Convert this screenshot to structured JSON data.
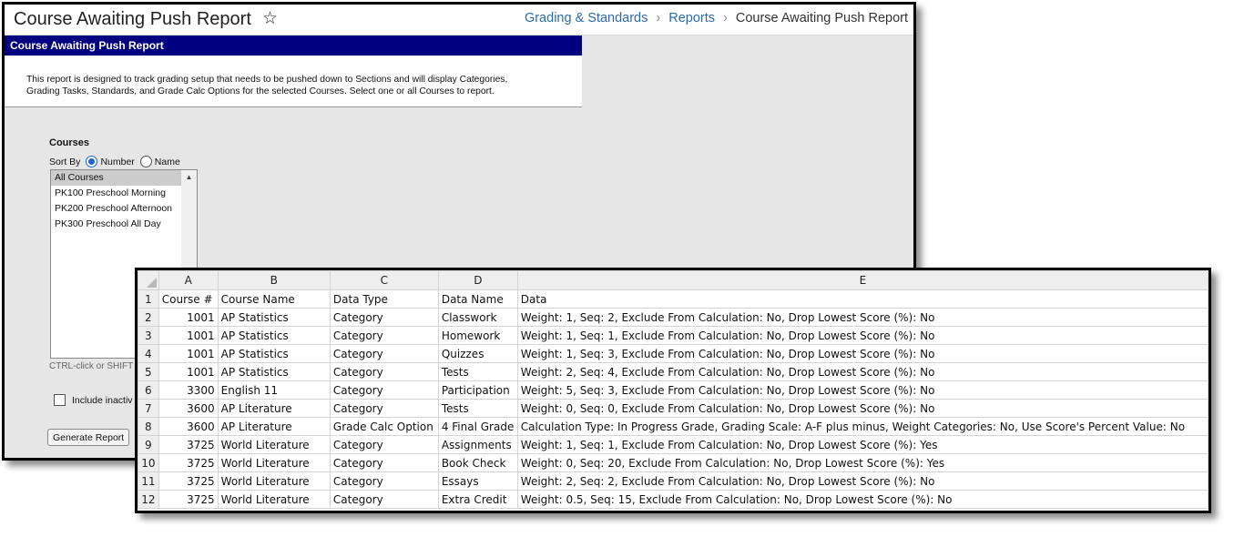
{
  "page": {
    "title": "Course Awaiting Push Report",
    "breadcrumb": [
      "Grading & Standards",
      "Reports",
      "Course Awaiting Push Report"
    ]
  },
  "report": {
    "header": "Course Awaiting Push Report",
    "description_line1": "This report is designed to track grading setup that needs to be pushed down to Sections and will display Categories,",
    "description_line2": "Grading Tasks, Standards, and Grade Calc Options for the selected Courses. Select one or all Courses to report.",
    "courses_label": "Courses",
    "sort_by_label": "Sort By",
    "sort_options": [
      "Number",
      "Name"
    ],
    "sort_selected": "Number",
    "course_options": [
      "All Courses",
      "PK100 Preschool Morning",
      "PK200 Preschool Afternoon",
      "PK300 Preschool All Day"
    ],
    "selected_course": "All Courses",
    "ctrl_hint": "CTRL-click or SHIFT",
    "include_inactive_label": "Include inactiv",
    "generate_button": "Generate Report"
  },
  "spreadsheet": {
    "columns": [
      "A",
      "B",
      "C",
      "D",
      "E"
    ],
    "rows": [
      {
        "n": "1",
        "cells": [
          "Course #",
          "Course Name",
          "Data Type",
          "Data Name",
          "Data"
        ]
      },
      {
        "n": "2",
        "cells": [
          "1001",
          "AP Statistics",
          "Category",
          "Classwork",
          "Weight: 1, Seq: 2, Exclude From Calculation: No, Drop Lowest Score (%): No"
        ]
      },
      {
        "n": "3",
        "cells": [
          "1001",
          "AP Statistics",
          "Category",
          "Homework",
          "Weight: 1, Seq: 1, Exclude From Calculation: No, Drop Lowest Score (%): No"
        ]
      },
      {
        "n": "4",
        "cells": [
          "1001",
          "AP Statistics",
          "Category",
          "Quizzes",
          "Weight: 1, Seq: 3, Exclude From Calculation: No, Drop Lowest Score (%): No"
        ]
      },
      {
        "n": "5",
        "cells": [
          "1001",
          "AP Statistics",
          "Category",
          "Tests",
          "Weight: 2, Seq: 4, Exclude From Calculation: No, Drop Lowest Score (%): No"
        ]
      },
      {
        "n": "6",
        "cells": [
          "3300",
          "English 11",
          "Category",
          "Participation",
          "Weight: 5, Seq: 3, Exclude From Calculation: No, Drop Lowest Score (%): No"
        ]
      },
      {
        "n": "7",
        "cells": [
          "3600",
          "AP Literature",
          "Category",
          "Tests",
          "Weight: 0, Seq: 0, Exclude From Calculation: No, Drop Lowest Score (%): No"
        ]
      },
      {
        "n": "8",
        "cells": [
          "3600",
          "AP Literature",
          "Grade Calc Option",
          "4 Final Grade",
          "Calculation Type: In Progress Grade, Grading Scale: A-F plus minus, Weight Categories: No, Use Score's Percent Value: No"
        ]
      },
      {
        "n": "9",
        "cells": [
          "3725",
          "World Literature",
          "Category",
          "Assignments",
          "Weight: 1, Seq: 1, Exclude From Calculation: No, Drop Lowest Score (%): Yes"
        ]
      },
      {
        "n": "10",
        "cells": [
          "3725",
          "World Literature",
          "Category",
          "Book Check",
          "Weight: 0, Seq: 20, Exclude From Calculation: No, Drop Lowest Score (%): Yes"
        ]
      },
      {
        "n": "11",
        "cells": [
          "3725",
          "World Literature",
          "Category",
          "Essays",
          "Weight: 2, Seq: 2, Exclude From Calculation: No, Drop Lowest Score (%): No"
        ]
      },
      {
        "n": "12",
        "cells": [
          "3725",
          "World Literature",
          "Category",
          "Extra Credit",
          "Weight: 0.5, Seq: 15, Exclude From Calculation: No, Drop Lowest Score (%): No"
        ]
      }
    ]
  },
  "colors": {
    "header_bar": "#000080",
    "link": "#2a6bb0",
    "radio_selected": "#1a66d2"
  },
  "icons": {
    "favorite": "star-icon",
    "breadcrumb_separator": "chevron-right-icon"
  }
}
